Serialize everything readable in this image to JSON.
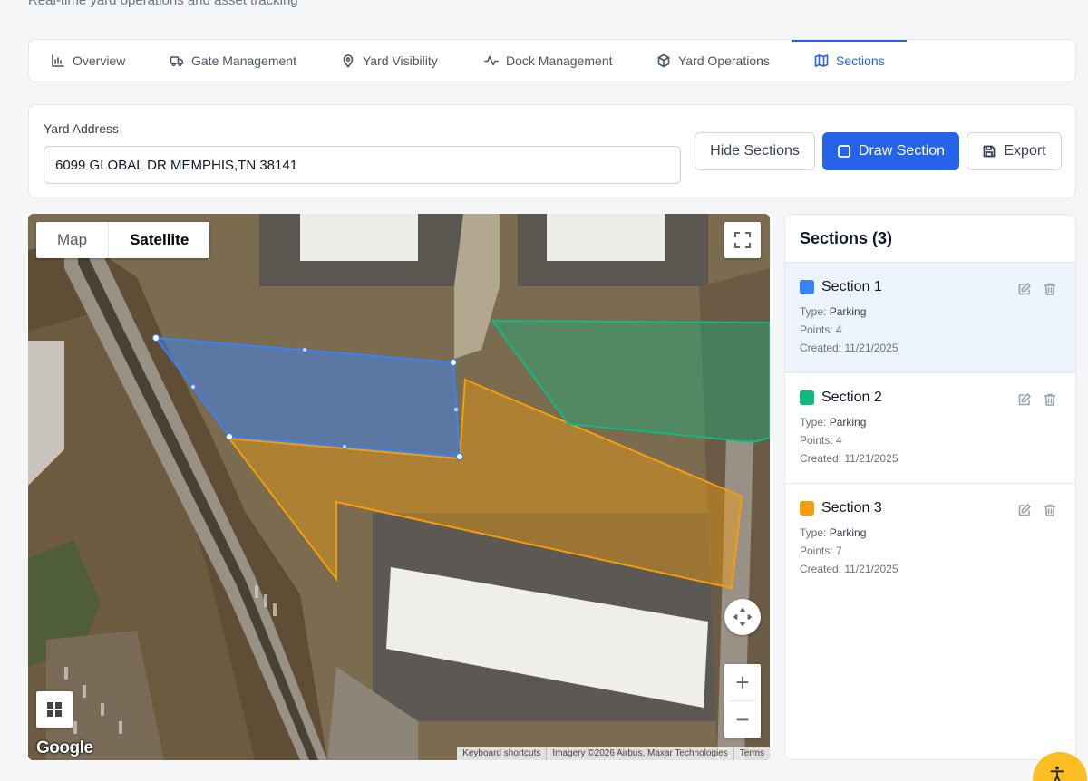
{
  "header": {
    "subtitle": "Real-time yard operations and asset tracking"
  },
  "tabs": [
    {
      "label": "Overview",
      "icon": "bar-chart-icon",
      "active": false
    },
    {
      "label": "Gate Management",
      "icon": "truck-icon",
      "active": false
    },
    {
      "label": "Yard Visibility",
      "icon": "map-pin-icon",
      "active": false
    },
    {
      "label": "Dock Management",
      "icon": "activity-icon",
      "active": false
    },
    {
      "label": "Yard Operations",
      "icon": "box-icon",
      "active": false
    },
    {
      "label": "Sections",
      "icon": "map-icon",
      "active": true
    }
  ],
  "address": {
    "label": "Yard Address",
    "value": "6099 GLOBAL DR MEMPHIS,TN 38141"
  },
  "toolbar": {
    "hide_label": "Hide Sections",
    "draw_label": "Draw Section",
    "export_label": "Export"
  },
  "map": {
    "map_type_map": "Map",
    "map_type_satellite": "Satellite",
    "selected_type": "Satellite",
    "logo": "Google",
    "attribution": {
      "shortcuts": "Keyboard shortcuts",
      "imagery": "Imagery ©2026 Airbus, Maxar Technologies",
      "terms": "Terms"
    },
    "zoom_in": "+",
    "zoom_out": "−"
  },
  "panel": {
    "title": "Sections (3)",
    "sections": [
      {
        "name": "Section 1",
        "color": "#3b82f6",
        "type_label": "Type: ",
        "type": "Parking",
        "points": "Points: 4",
        "created": "Created: 11/21/2025",
        "selected": true
      },
      {
        "name": "Section 2",
        "color": "#10b981",
        "type_label": "Type: ",
        "type": "Parking",
        "points": "Points: 4",
        "created": "Created: 11/21/2025",
        "selected": false
      },
      {
        "name": "Section 3",
        "color": "#f59e0b",
        "type_label": "Type: ",
        "type": "Parking",
        "points": "Points: 7",
        "created": "Created: 11/21/2025",
        "selected": false
      }
    ]
  },
  "colors": {
    "accent": "#2563eb",
    "section_blue": "#3b82f6",
    "section_green": "#10b981",
    "section_orange": "#f59e0b",
    "help_fab": "#fbbf24"
  }
}
